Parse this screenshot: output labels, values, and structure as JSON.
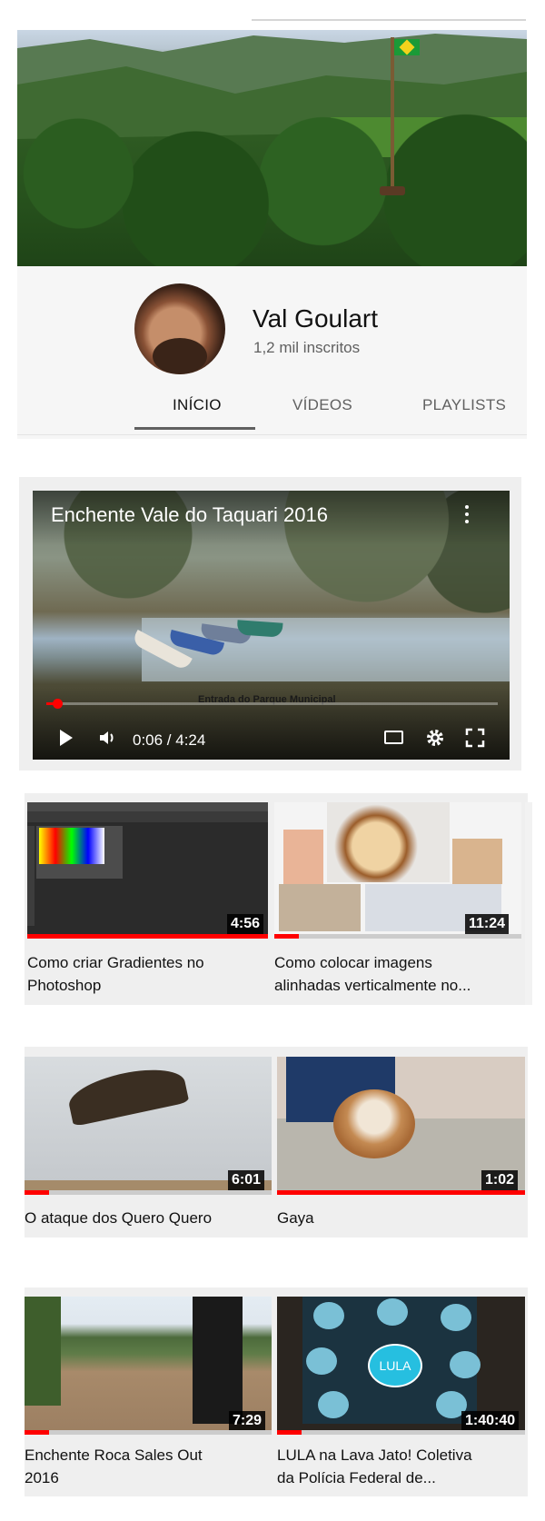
{
  "channel": {
    "name": "Val Goulart",
    "subscribers": "1,2 mil inscritos"
  },
  "tabs": [
    {
      "label": "INÍCIO",
      "active": true
    },
    {
      "label": "VÍDEOS",
      "active": false
    },
    {
      "label": "PLAYLISTS",
      "active": false
    }
  ],
  "featured": {
    "title": "Enchente Vale do Taquari 2016",
    "caption": "Entrada do Parque Municipal",
    "time": "0:06 / 4:24",
    "progress": 0.024
  },
  "videos": [
    {
      "title_line1": "Como criar Gradientes no",
      "title_line2": "Photoshop",
      "duration": "4:56",
      "watched": 1.0,
      "thumb": "photoshop-gradients"
    },
    {
      "title_line1": "Como colocar imagens",
      "title_line2": "alinhadas verticalmente no...",
      "duration": "11:24",
      "watched": 0.1,
      "thumb": "image-collage"
    },
    {
      "title_line1": "O ataque dos Quero Quero",
      "title_line2": "",
      "duration": "6:01",
      "watched": 0.1,
      "thumb": "bird"
    },
    {
      "title_line1": "Gaya",
      "title_line2": "",
      "duration": "1:02",
      "watched": 1.0,
      "thumb": "puppy"
    },
    {
      "title_line1": "Enchente Roca Sales Out",
      "title_line2": "2016",
      "duration": "7:29",
      "watched": 0.1,
      "thumb": "flood"
    },
    {
      "title_line1": "LULA na Lava Jato! Coletiva",
      "title_line2": "da Polícia Federal de...",
      "duration": "1:40:40",
      "watched": 0.1,
      "thumb": "lula-diagram"
    }
  ],
  "lula_thumb_center": "LULA",
  "colors": {
    "accent": "#ff0000",
    "tab_text": "#606060",
    "text": "#111111"
  }
}
